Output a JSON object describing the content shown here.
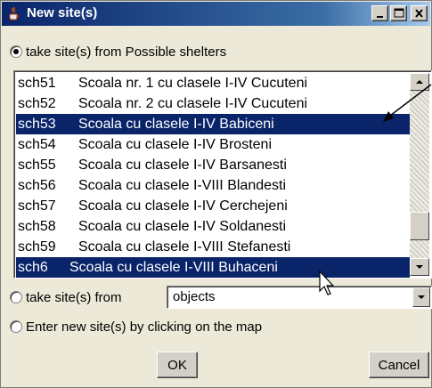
{
  "window": {
    "title": "New site(s)",
    "minimize_icon": "minimize-icon",
    "maximize_icon": "maximize-icon",
    "close_icon": "close-icon"
  },
  "options": {
    "possible_shelters_label": "take site(s) from Possible shelters",
    "take_from_label": "take site(s) from",
    "enter_on_map_label": "Enter new site(s) by clicking on the map",
    "selected": "possible_shelters"
  },
  "sites_list": [
    {
      "id": "sch51",
      "name": "Scoala nr. 1 cu clasele I-IV Cucuteni",
      "selected": false
    },
    {
      "id": "sch52",
      "name": "Scoala nr. 2 cu clasele I-IV Cucuteni",
      "selected": false
    },
    {
      "id": "sch53",
      "name": "Scoala cu clasele I-IV Babiceni",
      "selected": true
    },
    {
      "id": "sch54",
      "name": "Scoala cu clasele I-IV Brosteni",
      "selected": false
    },
    {
      "id": "sch55",
      "name": "Scoala cu clasele I-IV Barsanesti",
      "selected": false
    },
    {
      "id": "sch56",
      "name": "Scoala cu clasele I-VIII Blandesti",
      "selected": false
    },
    {
      "id": "sch57",
      "name": "Scoala cu clasele I-IV Cerchejeni",
      "selected": false
    },
    {
      "id": "sch58",
      "name": "Scoala cu clasele I-IV Soldanesti",
      "selected": false
    },
    {
      "id": "sch59",
      "name": "Scoala cu clasele I-VIII Stefanesti",
      "selected": false
    },
    {
      "id": "sch6",
      "name": "Scoala cu clasele I-VIII Buhaceni",
      "selected": true
    }
  ],
  "source_combo": {
    "value": "objects"
  },
  "buttons": {
    "ok": "OK",
    "cancel": "Cancel"
  },
  "colors": {
    "selection": "#0a246a",
    "titlebar": "#0a246a",
    "face": "#ece9d8"
  }
}
